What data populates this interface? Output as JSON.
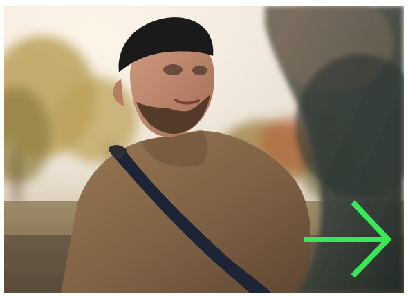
{
  "colors": {
    "arrow": "#38e85a",
    "sky": "#e8e2d6",
    "foliage": "#a58b4a",
    "sweater": "#8a6a48",
    "strap": "#1d2436",
    "beanie": "#1b1a1b",
    "skin": "#b9876c",
    "beard": "#4a3326",
    "foreground": "#2f3a34"
  },
  "icon": {
    "name": "arrow-right-icon"
  }
}
